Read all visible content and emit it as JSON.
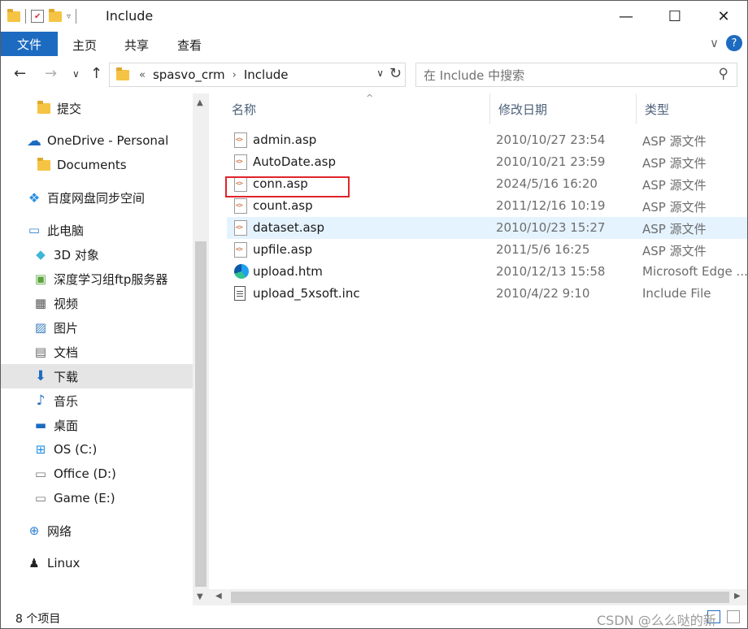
{
  "window": {
    "title": "Include",
    "minimize_glyph": "—",
    "maximize_glyph": "☐",
    "close_glyph": "✕"
  },
  "ribbon": {
    "file_tab": "文件",
    "tabs": [
      "主页",
      "共享",
      "查看"
    ],
    "expand_glyph": "∨",
    "help_glyph": "?"
  },
  "nav": {
    "back_glyph": "←",
    "forward_glyph": "→",
    "recent_glyph": "∨",
    "up_glyph": "↑",
    "breadcrumb_overflow": "«",
    "breadcrumb": [
      "spasvo_crm",
      "Include"
    ],
    "search_placeholder": "在 Include 中搜索"
  },
  "sidebar": {
    "items": [
      {
        "label": "提交",
        "icon": "folder-icon"
      },
      {
        "label": "OneDrive - Personal",
        "icon": "onedrive-icon"
      },
      {
        "label": "Documents",
        "icon": "folder-icon"
      },
      {
        "label": "百度网盘同步空间",
        "icon": "baidu-netdisk-icon"
      },
      {
        "label": "此电脑",
        "icon": "this-pc-icon"
      },
      {
        "label": "3D 对象",
        "icon": "3d-objects-icon"
      },
      {
        "label": "深度学习组ftp服务器",
        "icon": "network-location-icon"
      },
      {
        "label": "视频",
        "icon": "videos-icon"
      },
      {
        "label": "图片",
        "icon": "pictures-icon"
      },
      {
        "label": "文档",
        "icon": "documents-icon"
      },
      {
        "label": "下载",
        "icon": "downloads-icon"
      },
      {
        "label": "音乐",
        "icon": "music-icon"
      },
      {
        "label": "桌面",
        "icon": "desktop-icon"
      },
      {
        "label": "OS (C:)",
        "icon": "windows-drive-icon"
      },
      {
        "label": "Office (D:)",
        "icon": "drive-icon"
      },
      {
        "label": "Game (E:)",
        "icon": "drive-icon"
      },
      {
        "label": "网络",
        "icon": "network-icon"
      },
      {
        "label": "Linux",
        "icon": "linux-icon"
      }
    ],
    "selected": "下载"
  },
  "columns": {
    "name": "名称",
    "date": "修改日期",
    "type": "类型"
  },
  "files": [
    {
      "name": "admin.asp",
      "date": "2010/10/27 23:54",
      "type": "ASP 源文件",
      "icon": "asp-file-icon"
    },
    {
      "name": "AutoDate.asp",
      "date": "2010/10/21 23:59",
      "type": "ASP 源文件",
      "icon": "asp-file-icon"
    },
    {
      "name": "conn.asp",
      "date": "2024/5/16 16:20",
      "type": "ASP 源文件",
      "icon": "asp-file-icon"
    },
    {
      "name": "count.asp",
      "date": "2011/12/16 10:19",
      "type": "ASP 源文件",
      "icon": "asp-file-icon"
    },
    {
      "name": "dataset.asp",
      "date": "2010/10/23 15:27",
      "type": "ASP 源文件",
      "icon": "asp-file-icon"
    },
    {
      "name": "upfile.asp",
      "date": "2011/5/6 16:25",
      "type": "ASP 源文件",
      "icon": "asp-file-icon"
    },
    {
      "name": "upload.htm",
      "date": "2010/12/13 15:58",
      "type": "Microsoft Edge ...",
      "icon": "edge-icon"
    },
    {
      "name": "upload_5xsoft.inc",
      "date": "2010/4/22 9:10",
      "type": "Include File",
      "icon": "text-file-icon"
    }
  ],
  "hovered_file": "dataset.asp",
  "annotated_file": "conn.asp",
  "annotation_color": "#e0242a",
  "status": {
    "item_count": "8 个项目"
  },
  "watermark": "CSDN @么么哒的新",
  "accent_color": "#1d6bc0"
}
